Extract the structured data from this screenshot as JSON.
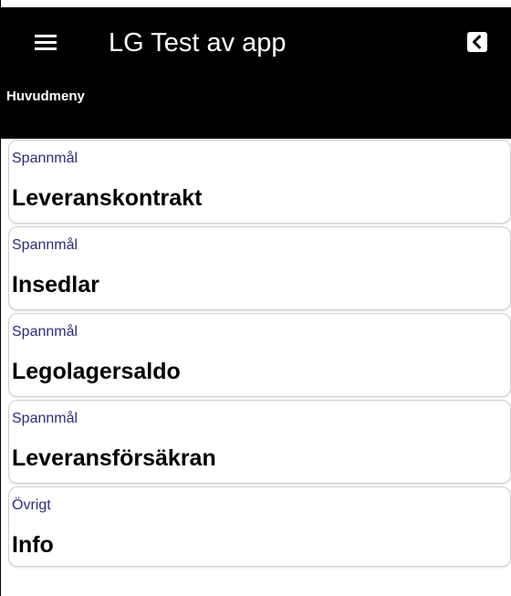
{
  "header": {
    "title": "LG Test av app",
    "subtitle": "Huvudmeny",
    "menu_icon": "hamburger-menu-icon",
    "back_icon": "back-arrow-icon",
    "background_color": "#000000",
    "text_color": "#ffffff"
  },
  "menu": {
    "items": [
      {
        "category": "Spannmål",
        "label": "Leveranskontrakt"
      },
      {
        "category": "Spannmål",
        "label": "Insedlar"
      },
      {
        "category": "Spannmål",
        "label": "Legolagersaldo"
      },
      {
        "category": "Spannmål",
        "label": "Leveransförsäkran"
      },
      {
        "category": "Övrigt",
        "label": "Info"
      }
    ],
    "category_color": "#2c2c7a",
    "label_color": "#000000"
  }
}
